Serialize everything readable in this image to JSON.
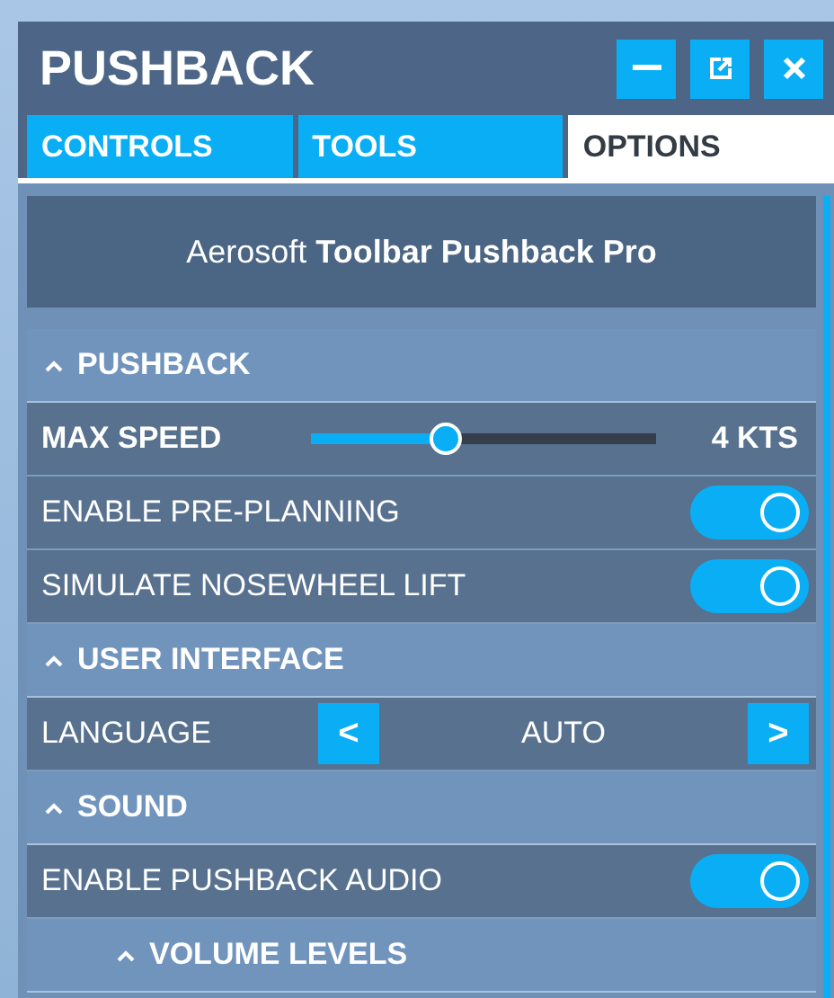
{
  "window": {
    "title": "PUSHBACK",
    "buttons": [
      {
        "kind": "minimize"
      },
      {
        "kind": "popout"
      },
      {
        "kind": "close"
      }
    ]
  },
  "tabs": [
    {
      "label": "CONTROLS",
      "selected": false
    },
    {
      "label": "TOOLS",
      "selected": false
    },
    {
      "label": "OPTIONS",
      "selected": true
    }
  ],
  "banner": "Aerosoft **Toolbar Pushback Pro**",
  "rows": [
    {
      "kind": "header",
      "label": "PUSHBACK",
      "expanded": true
    },
    {
      "kind": "slider",
      "label": "MAX SPEED",
      "level": 0.39,
      "reading": "4 KTS"
    },
    {
      "kind": "toggle",
      "label": "ENABLE PRE-PLANNING",
      "on": true
    },
    {
      "kind": "toggle",
      "label": "SIMULATE NOSEWHEEL LIFT",
      "on": true
    },
    {
      "kind": "header",
      "label": "USER INTERFACE",
      "expanded": true
    },
    {
      "kind": "selector",
      "label": "LANGUAGE",
      "value": "AUTO",
      "prev": "<",
      "next": ">"
    },
    {
      "kind": "header",
      "label": "SOUND",
      "expanded": true
    },
    {
      "kind": "toggle",
      "label": "ENABLE PUSHBACK AUDIO",
      "on": true
    },
    {
      "kind": "subheader",
      "label": "VOLUME LEVELS",
      "expanded": true
    }
  ]
}
